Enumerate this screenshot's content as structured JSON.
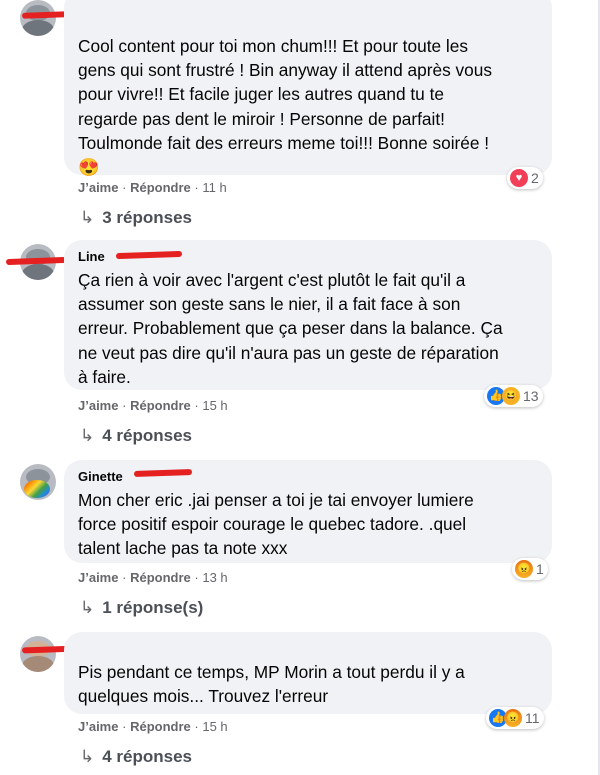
{
  "actions": {
    "like": "J’aime",
    "reply": "Répondre",
    "dot": "·"
  },
  "comments": [
    {
      "author": "",
      "text": "Cool content pour toi mon chum!!! Et pour toute les\ngens qui sont frustré ! Bin anyway il attend après vous\npour vivre!! Et facile juger les autres quand tu te\nregarde pas dent le miroir ! Personne de parfait!\nToulmonde fait des erreurs meme toi!!! Bonne soirée !\n😍",
      "reactions": [
        "love"
      ],
      "reaction_count": "2",
      "time": "11 h",
      "replies": "3 réponses"
    },
    {
      "author": "Line",
      "text": "Ça rien à voir avec l'argent c'est plutôt le fait qu'il a\nassumer son geste sans le nier, il a fait face à son\nerreur. Probablement que ça peser dans la balance. Ça\nne veut pas dire qu'il n'aura pas un geste de réparation\nà faire.",
      "reactions": [
        "like",
        "haha"
      ],
      "reaction_count": "13",
      "time": "15 h",
      "replies": "4 réponses"
    },
    {
      "author": "Ginette",
      "text": "Mon cher eric .jai penser a toi je tai envoyer lumiere\nforce positif espoir courage le quebec tadore. .quel\ntalent lache pas ta note xxx",
      "reactions": [
        "angry"
      ],
      "reaction_count": "1",
      "time": "13 h",
      "replies": "1 réponse(s)"
    },
    {
      "author": "",
      "text": "Pis pendant ce temps, MP Morin a tout perdu il y a\nquelques mois... Trouvez l'erreur",
      "reactions": [
        "like",
        "angry"
      ],
      "reaction_count": "11",
      "time": "15 h",
      "replies": "4 réponses"
    }
  ]
}
